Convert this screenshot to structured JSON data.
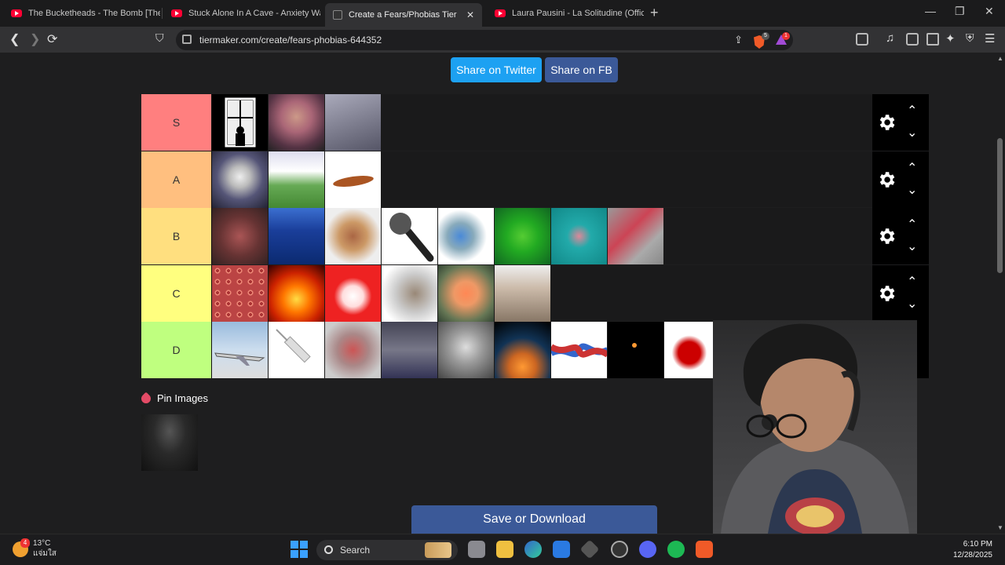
{
  "browser": {
    "tabs": [
      {
        "title": "The Bucketheads - The Bomb [These",
        "favicon": "youtube-icon",
        "active": false
      },
      {
        "title": "Stuck Alone In A Cave - Anxiety Warr",
        "favicon": "youtube-icon",
        "active": false
      },
      {
        "title": "Create a Fears/Phobias Tier List -",
        "favicon": "tiermaker-icon",
        "active": true
      },
      {
        "title": "Laura Pausini - La Solitudine (Official",
        "favicon": "youtube-icon",
        "active": false
      }
    ],
    "new_tab": "+",
    "tab_close": "✕",
    "url": "tiermaker.com/create/fears-phobias-644352",
    "brave_badge": "5",
    "alert_badge": "1"
  },
  "page": {
    "share_twitter": "Share on Twitter",
    "share_fb": "Share on FB",
    "tiers": [
      {
        "label": "S",
        "color": "#ff7f7f",
        "items": [
          "window-silhouette",
          "scared-girl",
          "glass-floor-view"
        ]
      },
      {
        "label": "A",
        "color": "#ffbf7f",
        "items": [
          "shark",
          "gravestone",
          "cockroach"
        ]
      },
      {
        "label": "B",
        "color": "#ffdf7f",
        "items": [
          "crowd",
          "ocean",
          "tarantula",
          "microphone",
          "virus",
          "green-snake",
          "sea-creature",
          "centipede"
        ]
      },
      {
        "label": "C",
        "color": "#ffff7f",
        "items": [
          "holes-pattern",
          "fire",
          "clown",
          "rat",
          "lizard",
          "scorpion-hand"
        ]
      },
      {
        "label": "D",
        "color": "#bfff7f",
        "items": [
          "airplane",
          "syringe",
          "puppet",
          "lightning",
          "man-portrait",
          "asteroid-earth",
          "rope-knot",
          "candle-dark",
          "blood-splatter",
          "alien",
          "red-item"
        ]
      }
    ],
    "chev_up": "⌃",
    "chev_down": "⌄",
    "pin_label": "Pin Images",
    "save_button": "Save or Download"
  },
  "taskbar": {
    "weather_temp": "13°C",
    "weather_desc": "แจ่มใส",
    "weather_badge": "4",
    "search_label": "Search",
    "time": "6:10 PM",
    "date": "12/28/2025"
  }
}
